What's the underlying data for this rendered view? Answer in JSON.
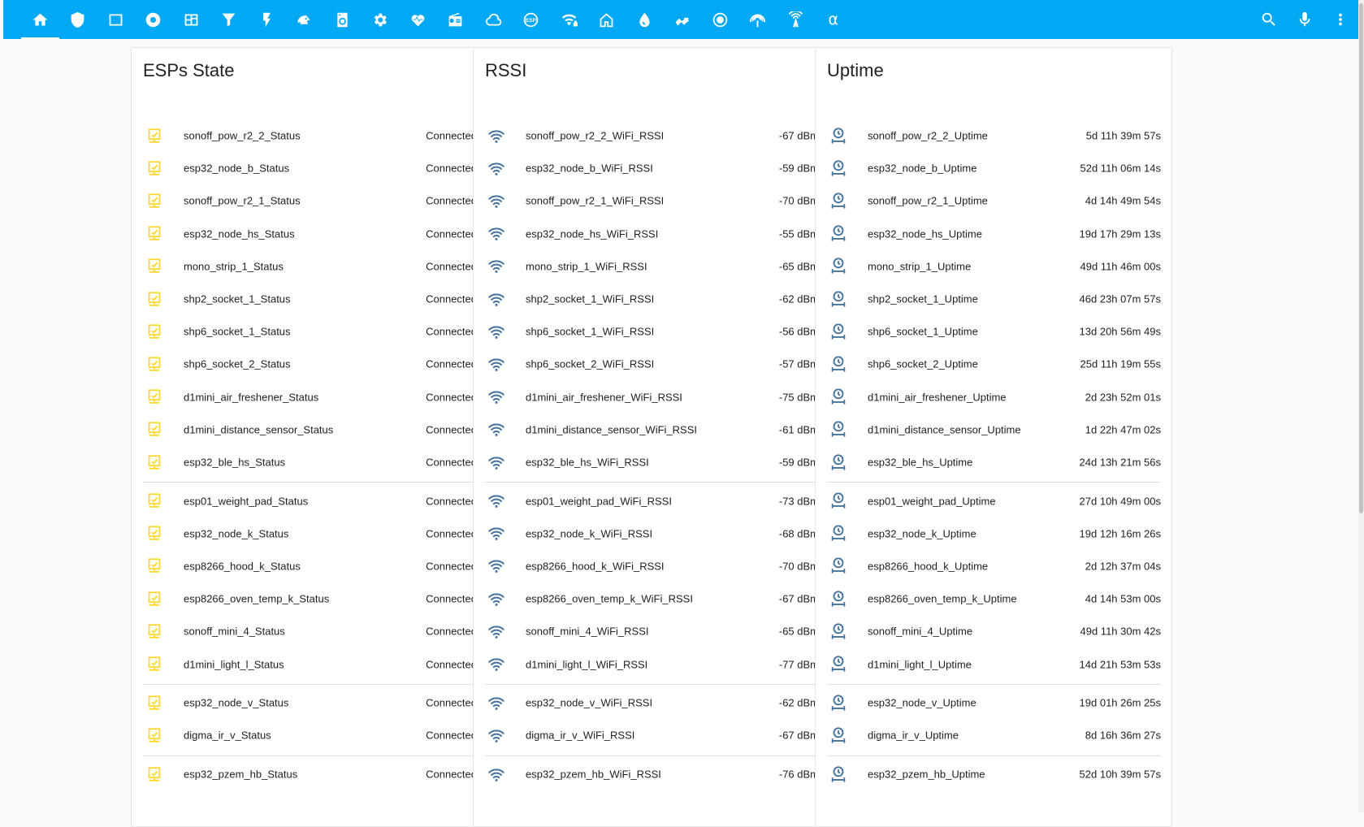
{
  "colors": {
    "header": "#03a9f4",
    "status_icon": "#fdd835",
    "entity_icon": "#44739e"
  },
  "topbar": {
    "tabs": [
      {
        "icon": "home-icon"
      },
      {
        "icon": "shield-icon"
      },
      {
        "icon": "square-outline-icon"
      },
      {
        "icon": "record-circle-icon"
      },
      {
        "icon": "view-dashboard-icon"
      },
      {
        "icon": "filter-icon"
      },
      {
        "icon": "flash-icon"
      },
      {
        "icon": "robot-vacuum-icon"
      },
      {
        "icon": "washing-machine-icon"
      },
      {
        "icon": "gear-icon"
      },
      {
        "icon": "heart-pulse-icon"
      },
      {
        "icon": "radio-icon"
      },
      {
        "icon": "cloud-icon"
      },
      {
        "icon": "esp-chip-icon"
      },
      {
        "icon": "wifi-lock-icon"
      },
      {
        "icon": "home-outline-icon"
      },
      {
        "icon": "water-drop-icon"
      },
      {
        "icon": "tune-icon"
      },
      {
        "icon": "radio-button-icon"
      },
      {
        "icon": "access-point-icon"
      },
      {
        "icon": "antenna-icon"
      },
      {
        "icon": "alpha-icon",
        "glyph": "α"
      }
    ],
    "actions": [
      {
        "icon": "search-icon"
      },
      {
        "icon": "microphone-icon"
      },
      {
        "icon": "more-vertical-icon"
      }
    ]
  },
  "cards": [
    {
      "title": "ESPs State",
      "icon": "status-monitor-icon",
      "rows": [
        {
          "name": "sonoff_pow_r2_2_Status",
          "value": "Connected"
        },
        {
          "name": "esp32_node_b_Status",
          "value": "Connected"
        },
        {
          "name": "sonoff_pow_r2_1_Status",
          "value": "Connected"
        },
        {
          "name": "esp32_node_hs_Status",
          "value": "Connected"
        },
        {
          "name": "mono_strip_1_Status",
          "value": "Connected"
        },
        {
          "name": "shp2_socket_1_Status",
          "value": "Connected"
        },
        {
          "name": "shp6_socket_1_Status",
          "value": "Connected"
        },
        {
          "name": "shp6_socket_2_Status",
          "value": "Connected"
        },
        {
          "name": "d1mini_air_freshener_Status",
          "value": "Connected"
        },
        {
          "name": "d1mini_distance_sensor_Status",
          "value": "Connected"
        },
        {
          "name": "esp32_ble_hs_Status",
          "value": "Connected"
        },
        {
          "name": "esp01_weight_pad_Status",
          "value": "Connected"
        },
        {
          "name": "esp32_node_k_Status",
          "value": "Connected"
        },
        {
          "name": "esp8266_hood_k_Status",
          "value": "Connected"
        },
        {
          "name": "esp8266_oven_temp_k_Status",
          "value": "Connected"
        },
        {
          "name": "sonoff_mini_4_Status",
          "value": "Connected"
        },
        {
          "name": "d1mini_light_l_Status",
          "value": "Connected"
        },
        {
          "name": "esp32_node_v_Status",
          "value": "Connected"
        },
        {
          "name": "digma_ir_v_Status",
          "value": "Connected"
        },
        {
          "name": "esp32_pzem_hb_Status",
          "value": "Connected"
        }
      ]
    },
    {
      "title": "RSSI",
      "icon": "wifi-icon",
      "rows": [
        {
          "name": "sonoff_pow_r2_2_WiFi_RSSI",
          "value": "-67 dBm"
        },
        {
          "name": "esp32_node_b_WiFi_RSSI",
          "value": "-59 dBm"
        },
        {
          "name": "sonoff_pow_r2_1_WiFi_RSSI",
          "value": "-70 dBm"
        },
        {
          "name": "esp32_node_hs_WiFi_RSSI",
          "value": "-55 dBm"
        },
        {
          "name": "mono_strip_1_WiFi_RSSI",
          "value": "-65 dBm"
        },
        {
          "name": "shp2_socket_1_WiFi_RSSI",
          "value": "-62 dBm"
        },
        {
          "name": "shp6_socket_1_WiFi_RSSI",
          "value": "-56 dBm"
        },
        {
          "name": "shp6_socket_2_WiFi_RSSI",
          "value": "-57 dBm"
        },
        {
          "name": "d1mini_air_freshener_WiFi_RSSI",
          "value": "-75 dBm"
        },
        {
          "name": "d1mini_distance_sensor_WiFi_RSSI",
          "value": "-61 dBm"
        },
        {
          "name": "esp32_ble_hs_WiFi_RSSI",
          "value": "-59 dBm"
        },
        {
          "name": "esp01_weight_pad_WiFi_RSSI",
          "value": "-73 dBm"
        },
        {
          "name": "esp32_node_k_WiFi_RSSI",
          "value": "-68 dBm"
        },
        {
          "name": "esp8266_hood_k_WiFi_RSSI",
          "value": "-70 dBm"
        },
        {
          "name": "esp8266_oven_temp_k_WiFi_RSSI",
          "value": "-67 dBm"
        },
        {
          "name": "sonoff_mini_4_WiFi_RSSI",
          "value": "-65 dBm"
        },
        {
          "name": "d1mini_light_l_WiFi_RSSI",
          "value": "-77 dBm"
        },
        {
          "name": "esp32_node_v_WiFi_RSSI",
          "value": "-62 dBm"
        },
        {
          "name": "digma_ir_v_WiFi_RSSI",
          "value": "-67 dBm"
        },
        {
          "name": "esp32_pzem_hb_WiFi_RSSI",
          "value": "-76 dBm"
        }
      ]
    },
    {
      "title": "Uptime",
      "icon": "timer-clock-icon",
      "rows": [
        {
          "name": "sonoff_pow_r2_2_Uptime",
          "value": "5d 11h 39m 57s"
        },
        {
          "name": "esp32_node_b_Uptime",
          "value": "52d 11h 06m 14s"
        },
        {
          "name": "sonoff_pow_r2_1_Uptime",
          "value": "4d 14h 49m 54s"
        },
        {
          "name": "esp32_node_hs_Uptime",
          "value": "19d 17h 29m 13s"
        },
        {
          "name": "mono_strip_1_Uptime",
          "value": "49d 11h 46m 00s"
        },
        {
          "name": "shp2_socket_1_Uptime",
          "value": "46d 23h 07m 57s"
        },
        {
          "name": "shp6_socket_1_Uptime",
          "value": "13d 20h 56m 49s"
        },
        {
          "name": "shp6_socket_2_Uptime",
          "value": "25d 11h 19m 55s"
        },
        {
          "name": "d1mini_air_freshener_Uptime",
          "value": "2d 23h 52m 01s"
        },
        {
          "name": "d1mini_distance_sensor_Uptime",
          "value": "1d 22h 47m 02s"
        },
        {
          "name": "esp32_ble_hs_Uptime",
          "value": "24d 13h 21m 56s"
        },
        {
          "name": "esp01_weight_pad_Uptime",
          "value": "27d 10h 49m 00s"
        },
        {
          "name": "esp32_node_k_Uptime",
          "value": "19d 12h 16m 26s"
        },
        {
          "name": "esp8266_hood_k_Uptime",
          "value": "2d 12h 37m 04s"
        },
        {
          "name": "esp8266_oven_temp_k_Uptime",
          "value": "4d 14h 53m 00s"
        },
        {
          "name": "sonoff_mini_4_Uptime",
          "value": "49d 11h 30m 42s"
        },
        {
          "name": "d1mini_light_l_Uptime",
          "value": "14d 21h 53m 53s"
        },
        {
          "name": "esp32_node_v_Uptime",
          "value": "19d 01h 26m 25s"
        },
        {
          "name": "digma_ir_v_Uptime",
          "value": "8d 16h 36m 27s"
        },
        {
          "name": "esp32_pzem_hb_Uptime",
          "value": "52d 10h 39m 57s"
        }
      ]
    }
  ]
}
